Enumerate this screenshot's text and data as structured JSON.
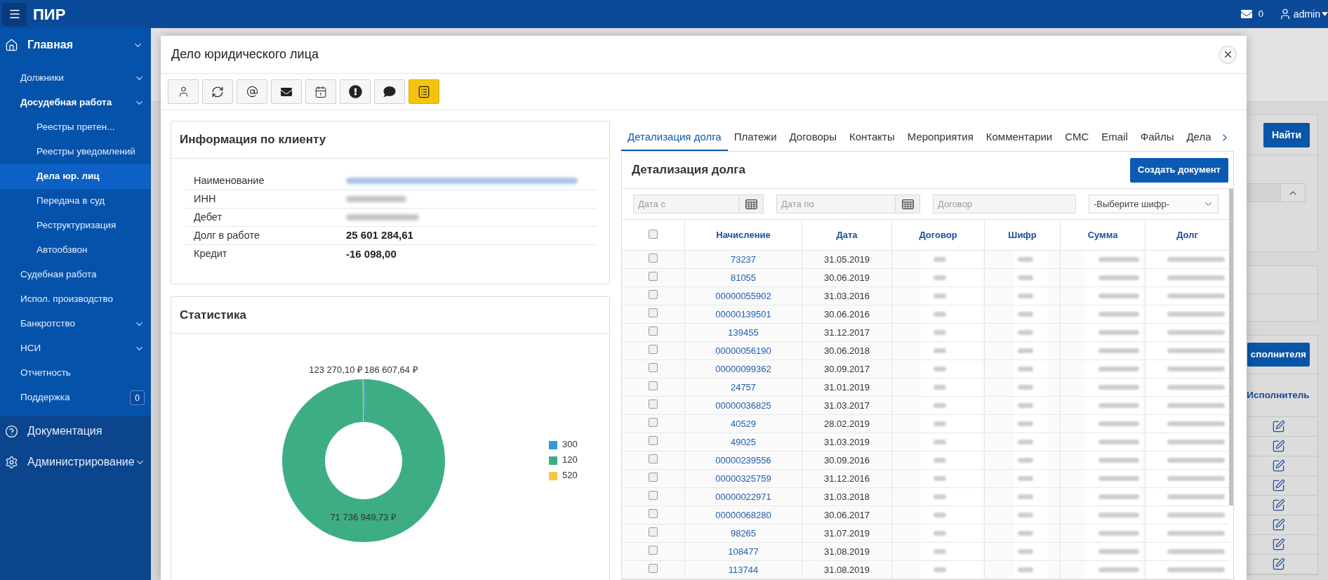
{
  "topbar": {
    "app_title": "ПИР",
    "mail_count": "0",
    "user": "admin"
  },
  "sidebar": {
    "items": [
      {
        "label": "Главная",
        "selected": false,
        "expandable": true,
        "children": [
          {
            "label": "Должники",
            "selected": false,
            "expandable": true
          },
          {
            "label": "Досудебная работа",
            "selected": false,
            "expandable": true,
            "children": [
              {
                "label": "Реестры претен...",
                "selected": false,
                "expandable": false
              },
              {
                "label": "Реестры уведомлений",
                "selected": false,
                "expandable": false
              },
              {
                "label": "Дела юр. лиц",
                "selected": true,
                "expandable": false
              },
              {
                "label": "Передача в суд",
                "selected": false,
                "expandable": false
              },
              {
                "label": "Реструктуризация",
                "selected": false,
                "expandable": false
              },
              {
                "label": "Автообзвон",
                "selected": false,
                "expandable": false
              }
            ]
          },
          {
            "label": "Судебная работа",
            "selected": false,
            "expandable": false
          },
          {
            "label": "Испол. производство",
            "selected": false,
            "expandable": false
          },
          {
            "label": "Банкротство",
            "selected": false,
            "expandable": true
          },
          {
            "label": "НСИ",
            "selected": false,
            "expandable": true
          },
          {
            "label": "Отчетность",
            "selected": false,
            "expandable": false
          },
          {
            "label": "Поддержка",
            "selected": false,
            "expandable": false,
            "badge": "0"
          }
        ]
      },
      {
        "label": "Документация",
        "selected": false,
        "expandable": false
      },
      {
        "label": "Администрирование",
        "selected": false,
        "expandable": true
      }
    ]
  },
  "modal": {
    "title": "Дело юридического лица",
    "toolbar": [
      {
        "selected": false
      },
      {
        "selected": false
      },
      {
        "selected": false
      },
      {
        "selected": false
      },
      {
        "selected": false
      },
      {
        "selected": false
      },
      {
        "selected": false
      },
      {
        "selected": true
      }
    ]
  },
  "client_info": {
    "title": "Информация по клиенту",
    "rows": [
      {
        "label": "Наименование",
        "masked": true,
        "link": true
      },
      {
        "label": "ИНН",
        "masked": true,
        "link": false
      },
      {
        "label": "Дебет",
        "masked": true,
        "link": false
      },
      {
        "label": "Долг в работе",
        "masked": false,
        "link": false,
        "value": "25 601 284,61"
      },
      {
        "label": "Кредит",
        "masked": false,
        "link": false,
        "value": "-16 098,00"
      }
    ]
  },
  "statistics": {
    "title": "Статистика",
    "chart_data": {
      "type": "donut",
      "categories": [
        "300",
        "120",
        "520"
      ],
      "values": [
        186607.64,
        71736949.73,
        123270.1
      ],
      "value_labels": [
        "186 607,64 ₽",
        "71 736 949,73 ₽",
        "123 270,10 ₽"
      ],
      "colors": [
        "#3498db",
        "#3dae84",
        "#f8c740"
      ],
      "legend": "right"
    }
  },
  "debt": {
    "tabs": [
      {
        "label": "Детализация долга",
        "selected": true
      },
      {
        "label": "Платежи",
        "selected": false
      },
      {
        "label": "Договоры",
        "selected": false
      },
      {
        "label": "Контакты",
        "selected": false
      },
      {
        "label": "Мероприятия",
        "selected": false
      },
      {
        "label": "Комментарии",
        "selected": false
      },
      {
        "label": "СМС",
        "selected": false
      },
      {
        "label": "Email",
        "selected": false
      },
      {
        "label": "Файлы",
        "selected": false
      },
      {
        "label": "Дела",
        "selected": false
      }
    ],
    "title": "Детализация долга",
    "create_button": "Создать документ",
    "filters": [
      {
        "kind": "date",
        "placeholder": "Дата с"
      },
      {
        "kind": "date",
        "placeholder": "Дата по"
      },
      {
        "kind": "text",
        "placeholder": "Договор"
      },
      {
        "kind": "select",
        "value": "-Выберите шифр-"
      }
    ],
    "table": {
      "all_checked": false,
      "columns": [
        "Начисление",
        "Дата",
        "Договор",
        "Шифр",
        "Сумма",
        "Долг"
      ],
      "rows": [
        {
          "checked": false,
          "accrual": "73237",
          "date": "31.05.2019"
        },
        {
          "checked": false,
          "accrual": "81055",
          "date": "30.06.2019"
        },
        {
          "checked": false,
          "accrual": "00000055902",
          "date": "31.03.2016"
        },
        {
          "checked": false,
          "accrual": "00000139501",
          "date": "30.06.2016"
        },
        {
          "checked": false,
          "accrual": "139455",
          "date": "31.12.2017"
        },
        {
          "checked": false,
          "accrual": "00000056190",
          "date": "30.06.2018"
        },
        {
          "checked": false,
          "accrual": "00000099362",
          "date": "30.09.2017"
        },
        {
          "checked": false,
          "accrual": "24757",
          "date": "31.01.2019"
        },
        {
          "checked": false,
          "accrual": "00000036825",
          "date": "31.03.2017"
        },
        {
          "checked": false,
          "accrual": "40529",
          "date": "28.02.2019"
        },
        {
          "checked": false,
          "accrual": "49025",
          "date": "31.03.2019"
        },
        {
          "checked": false,
          "accrual": "00000239556",
          "date": "30.09.2016"
        },
        {
          "checked": false,
          "accrual": "00000325759",
          "date": "31.12.2016"
        },
        {
          "checked": false,
          "accrual": "00000022971",
          "date": "31.03.2018"
        },
        {
          "checked": false,
          "accrual": "00000068280",
          "date": "30.06.2017"
        },
        {
          "checked": false,
          "accrual": "98265",
          "date": "31.07.2019"
        },
        {
          "checked": false,
          "accrual": "108477",
          "date": "31.08.2019"
        },
        {
          "checked": false,
          "accrual": "113744",
          "date": "31.08.2019"
        }
      ]
    }
  },
  "background": {
    "search_button": "Найти",
    "assign_button": "сполнителя",
    "column": "Исполнитель"
  }
}
